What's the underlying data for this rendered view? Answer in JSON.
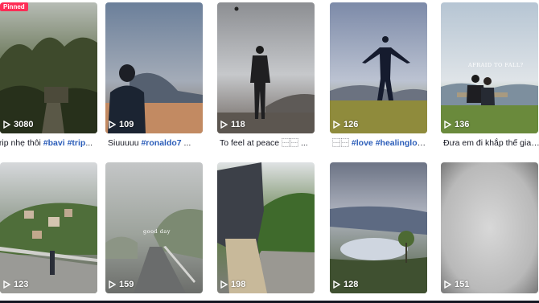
{
  "grid": {
    "row1": [
      {
        "views": "3080",
        "pinned_label": "Pinned",
        "caption_text": "trip nhẹ thôi ",
        "tags": [
          "#bavi",
          "#trip"
        ],
        "tail": "..."
      },
      {
        "views": "109",
        "caption_text": "Siuuuuu ",
        "tags": [
          "#ronaldo7"
        ],
        "tail": " ..."
      },
      {
        "views": "118",
        "caption_text": "To feel at peace ⿱⿱ ...",
        "tags": [],
        "tail": ""
      },
      {
        "views": "126",
        "caption_text": "⿱⿱ ",
        "tags": [
          "#love",
          "#healinglove"
        ],
        "tail": " ..."
      },
      {
        "views": "136",
        "caption_text": "Đưa em đi khắp thế gian...",
        "tags": [],
        "tail": "",
        "overlay": "AFRAID TO FALL?"
      }
    ],
    "row2": [
      {
        "views": "123"
      },
      {
        "views": "159",
        "overlay": "good day"
      },
      {
        "views": "198"
      },
      {
        "views": "128"
      },
      {
        "views": "151"
      }
    ]
  },
  "colors": {
    "accent_pinned": "#fe2c55",
    "hashtag": "#2b5db9",
    "text": "#161823"
  },
  "icons": {
    "views": "play-icon"
  }
}
